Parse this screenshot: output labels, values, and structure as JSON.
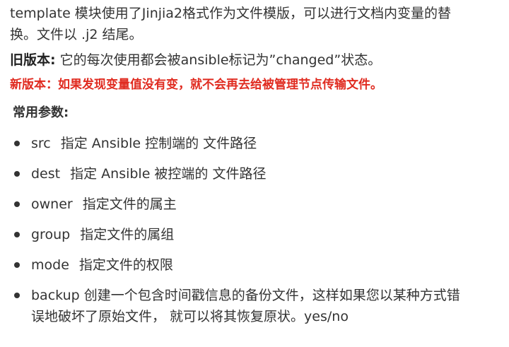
{
  "intro": {
    "line1": "template 模块使用了Jinjia2格式作为文件模版，可以进行文档内变量的替",
    "line2": "换。文件以 .j2 结尾。"
  },
  "old_version": {
    "label": "旧版本:",
    "text": " 它的每次使用都会被ansible标记为”changed”状态。"
  },
  "new_version": {
    "text": "新版本：如果发现变量值没有变，就不会再去给被管理节点传输文件。"
  },
  "params_title": "常用参数:",
  "params": [
    {
      "name": "src",
      "desc": "指定 Ansible 控制端的 文件路径"
    },
    {
      "name": "dest",
      "desc": "指定 Ansible 被控端的 文件路径"
    },
    {
      "name": "owner",
      "desc": "指定文件的属主"
    },
    {
      "name": "group",
      "desc": "指定文件的属组"
    },
    {
      "name": "mode",
      "desc": "指定文件的权限"
    },
    {
      "name": "backup",
      "desc": "创建一个包含时间戳信息的备份文件，这样如果您以某种方式错",
      "desc2": "误地破坏了原始文件， 就可以将其恢复原状。yes/no"
    }
  ],
  "colors": {
    "text": "#333333",
    "highlight": "#e02b20",
    "background": "#ffffff"
  }
}
